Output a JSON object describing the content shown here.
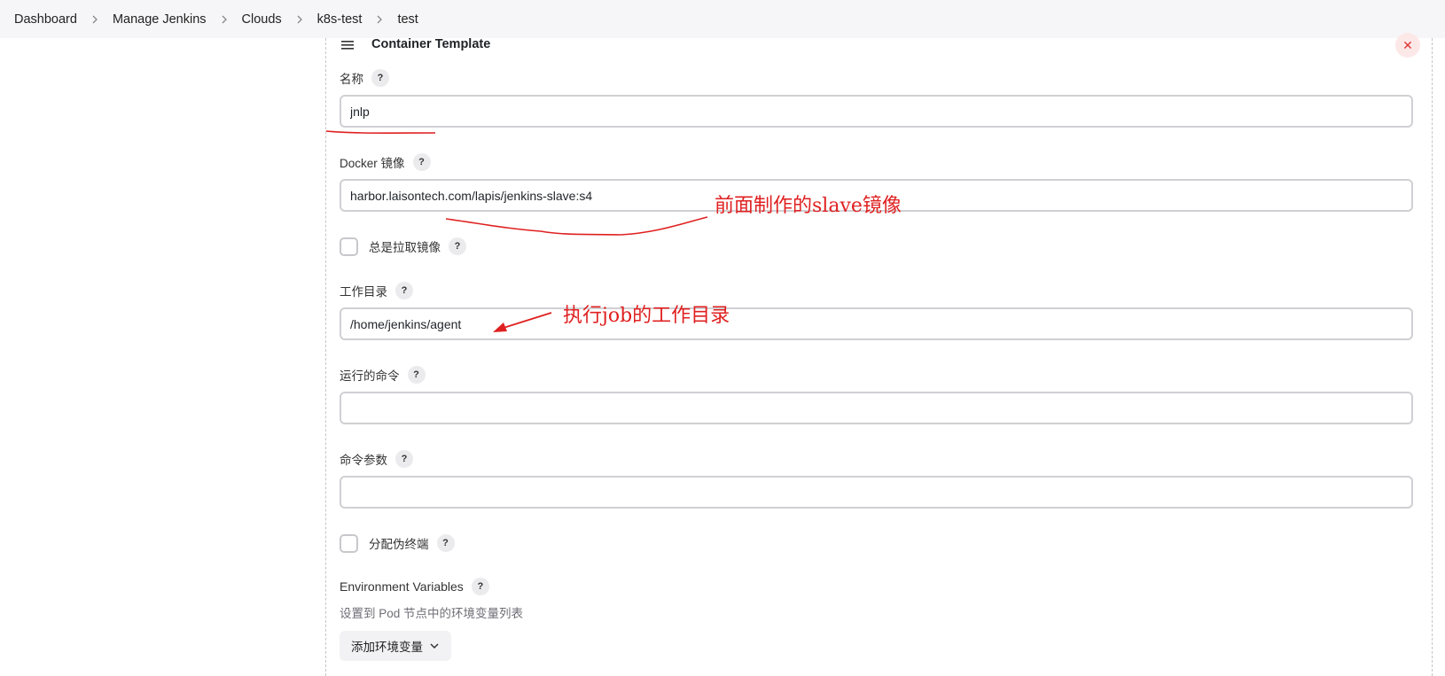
{
  "breadcrumb": [
    "Dashboard",
    "Manage Jenkins",
    "Clouds",
    "k8s-test",
    "test"
  ],
  "panel": {
    "title": "Container Template",
    "close_symbol": "✕",
    "help_symbol": "?"
  },
  "fields": {
    "name": {
      "label": "名称",
      "value": "jnlp"
    },
    "docker_image": {
      "label": "Docker 镜像",
      "value": "harbor.laisontech.com/lapis/jenkins-slave:s4"
    },
    "always_pull": {
      "label": "总是拉取镜像",
      "checked": false
    },
    "working_dir": {
      "label": "工作目录",
      "value": "/home/jenkins/agent"
    },
    "command": {
      "label": "运行的命令",
      "value": ""
    },
    "args": {
      "label": "命令参数",
      "value": ""
    },
    "tty": {
      "label": "分配伪终端",
      "checked": false
    },
    "env_vars": {
      "label": "Environment Variables",
      "description": "设置到 Pod 节点中的环境变量列表",
      "add_button": "添加环境变量"
    }
  },
  "annotations": {
    "slave_image": "前面制作的slave镜像",
    "work_dir": "执行job的工作目录",
    "color": "#e02020"
  },
  "icons": [
    "chevron-right-icon",
    "drag-handle-icon",
    "close-icon",
    "help-icon",
    "chevron-down-icon"
  ]
}
